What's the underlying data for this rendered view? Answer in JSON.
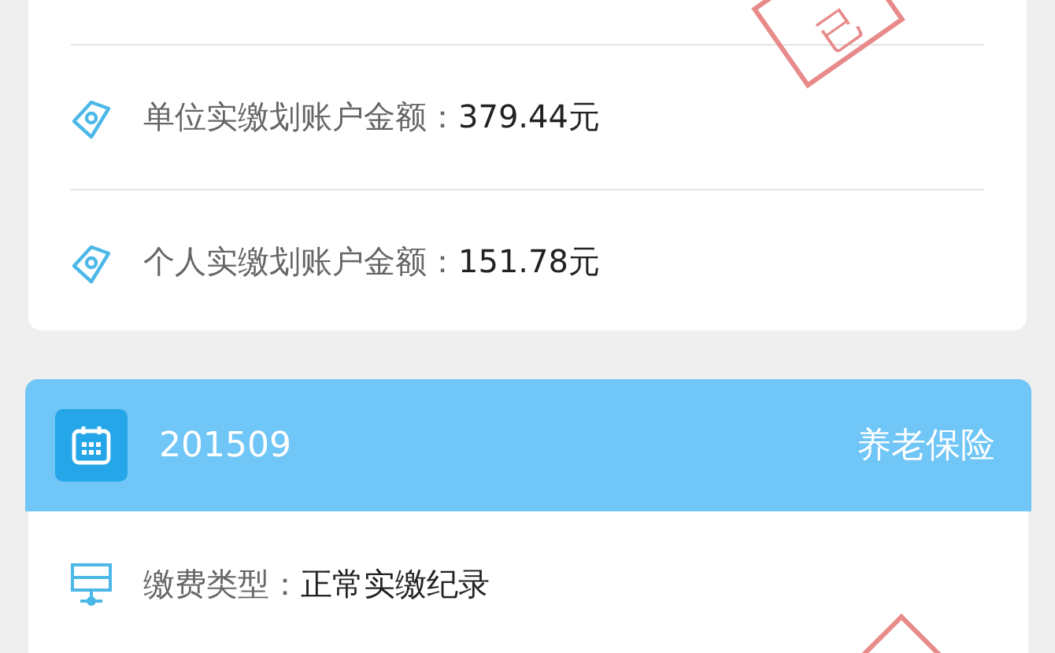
{
  "summary_card": {
    "stamp": "已",
    "rows": [
      {
        "kind": "money",
        "label": "单位实缴划账户金额：",
        "value": "379.44元"
      },
      {
        "kind": "money",
        "label": "个人实缴划账户金额：",
        "value": "151.78元"
      }
    ]
  },
  "record_card": {
    "period": "201509",
    "insurance": "养老保险",
    "rows": [
      {
        "kind": "type",
        "label": "缴费类型：",
        "value": "正常实缴纪录"
      }
    ]
  }
}
